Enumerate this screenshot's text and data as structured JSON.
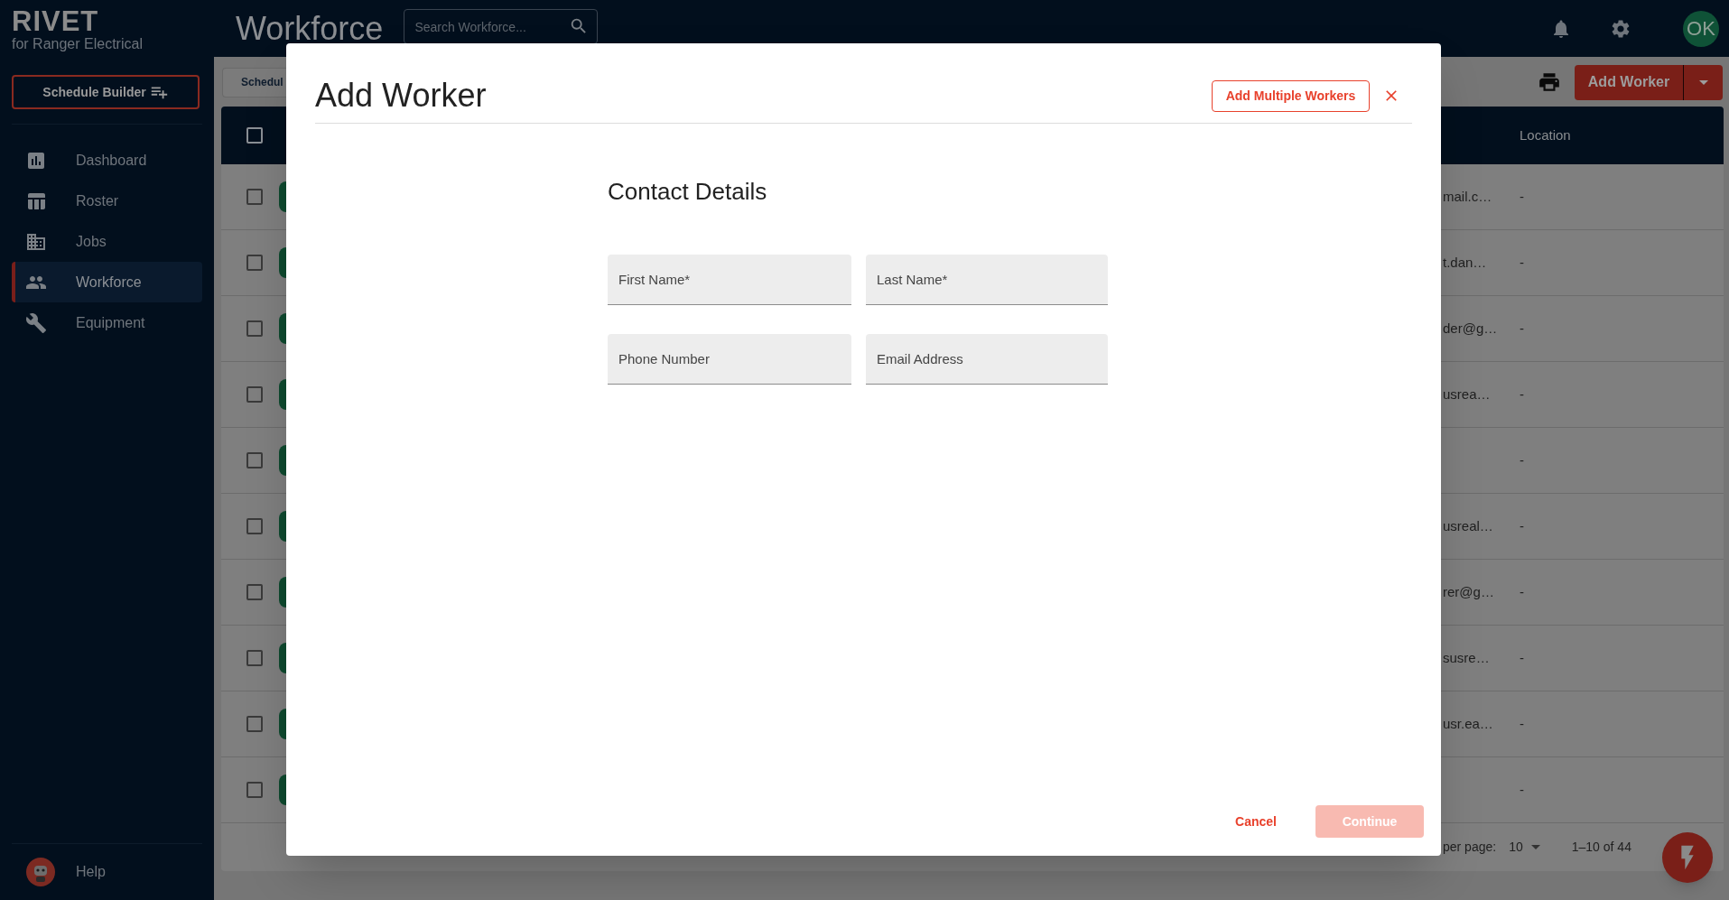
{
  "sidebar": {
    "logo": "RIVET",
    "subtitle": "for Ranger Electrical",
    "schedule_button": "Schedule Builder",
    "nav": [
      {
        "label": "Dashboard",
        "selected": false
      },
      {
        "label": "Roster",
        "selected": false
      },
      {
        "label": "Jobs",
        "selected": false
      },
      {
        "label": "Workforce",
        "selected": true
      },
      {
        "label": "Equipment",
        "selected": false
      }
    ],
    "help": "Help"
  },
  "header": {
    "title": "Workforce",
    "search": {
      "placeholder": "Search Workforce..."
    },
    "avatar": "OK"
  },
  "toolbar": {
    "tab": "Schedul",
    "add_button": "Add Worker"
  },
  "table": {
    "header_checked": false,
    "location_header": "Location",
    "rows": [
      {
        "checked": false,
        "email": "mail.c…",
        "location": "-"
      },
      {
        "checked": false,
        "email": "t.dan…",
        "location": "-"
      },
      {
        "checked": false,
        "email": "der@g…",
        "location": "-"
      },
      {
        "checked": false,
        "email": "usrea…",
        "location": "-"
      },
      {
        "checked": false,
        "location": "-"
      },
      {
        "checked": false,
        "email": "usreal…",
        "location": "-"
      },
      {
        "checked": false,
        "email": "rer@g…",
        "location": "-"
      },
      {
        "checked": false,
        "email": "susre…",
        "location": "-"
      },
      {
        "checked": false,
        "email": "usr.ea…",
        "location": "-"
      },
      {
        "checked": false,
        "location": "-"
      }
    ],
    "footer": {
      "rows_per_page_label": "per page:",
      "rows_per_page": "10",
      "range": "1–10 of 44"
    }
  },
  "dialog": {
    "title": "Add Worker",
    "multiple_button": "Add Multiple Workers",
    "section_title": "Contact Details",
    "fields": [
      {
        "placeholder": "First Name*"
      },
      {
        "placeholder": "Last Name*"
      },
      {
        "placeholder": "Phone Number"
      },
      {
        "placeholder": "Email Address"
      }
    ],
    "cancel_button": "Cancel",
    "continue_button": {
      "label": "Continue",
      "disabled": true
    }
  }
}
